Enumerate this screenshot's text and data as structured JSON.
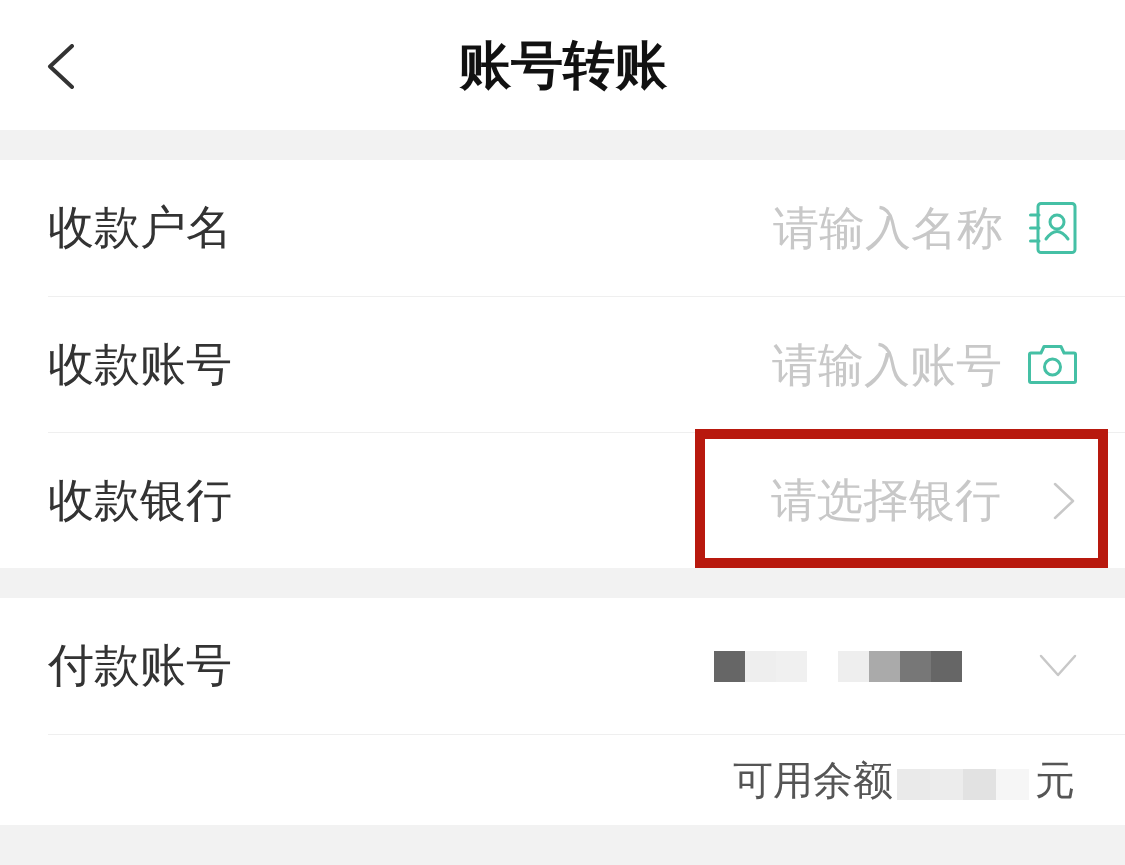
{
  "header": {
    "title": "账号转账"
  },
  "payee_fields": [
    {
      "label": "收款户名",
      "placeholder": "请输入名称",
      "kind": "contact",
      "highlighted": false
    },
    {
      "label": "收款账号",
      "placeholder": "请输入账号",
      "kind": "camera",
      "highlighted": false
    },
    {
      "label": "收款银行",
      "placeholder": "请选择银行",
      "kind": "select",
      "highlighted": true
    }
  ],
  "payer": {
    "label": "付款账号",
    "balance_label": "可用余额",
    "balance_unit": "元"
  }
}
